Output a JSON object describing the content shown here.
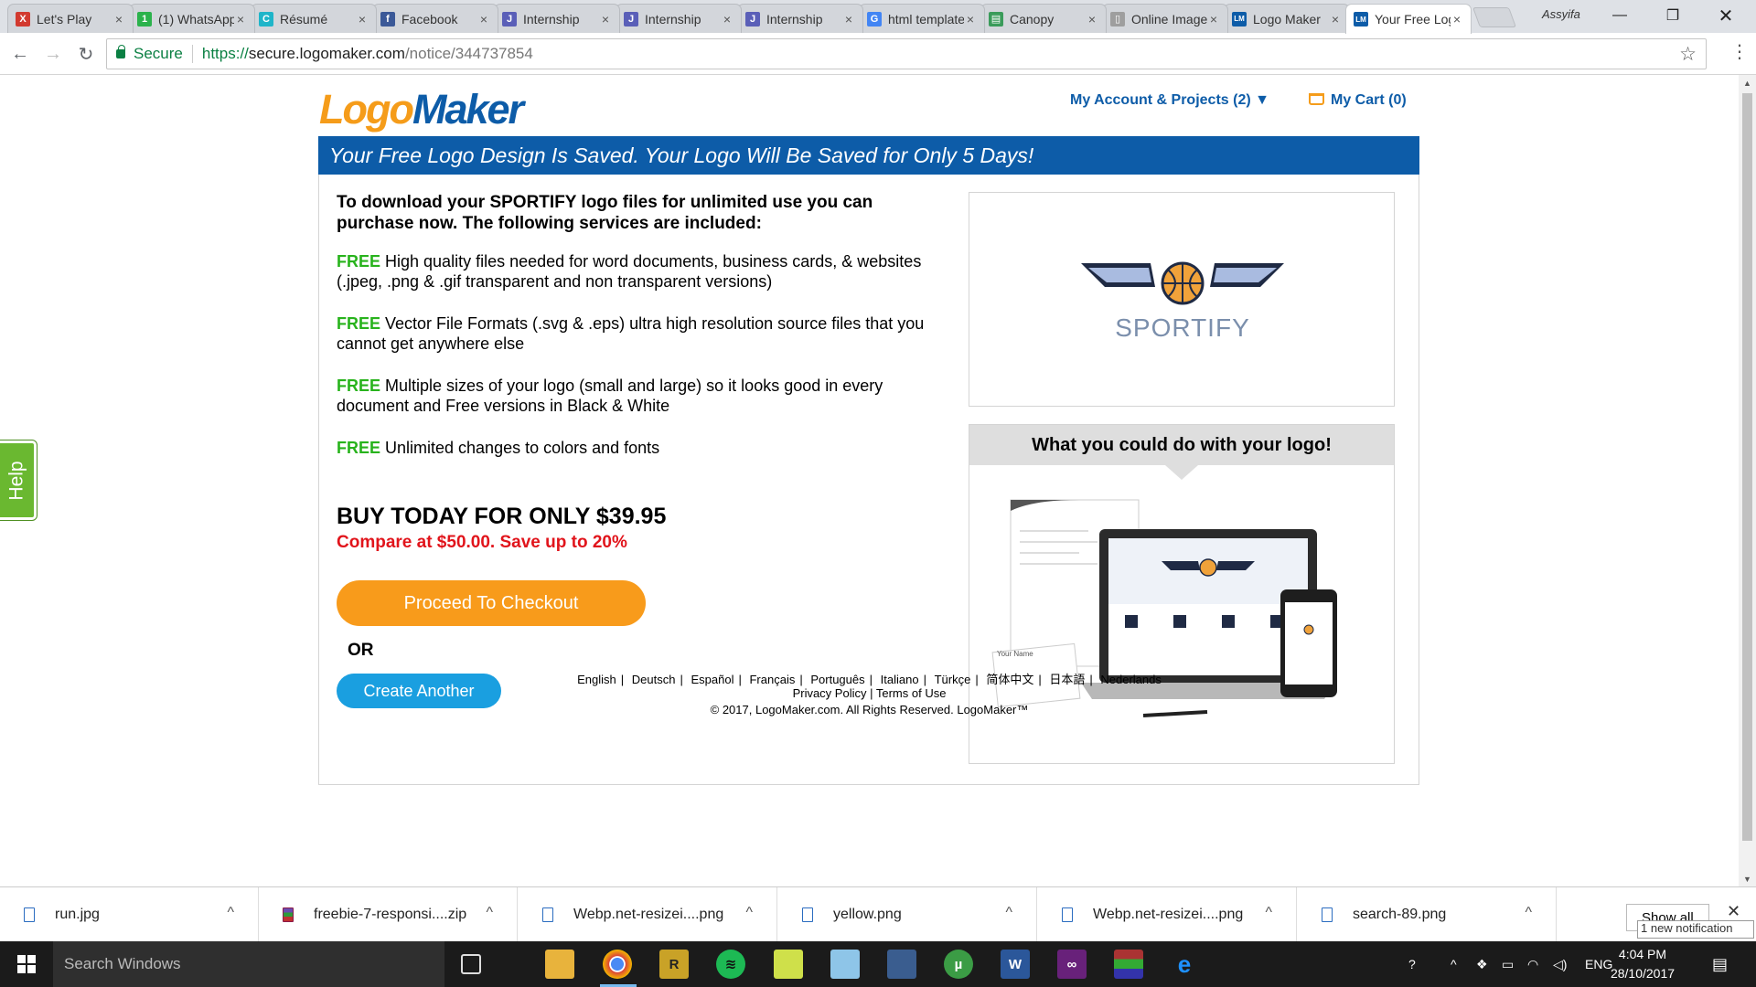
{
  "browser": {
    "tabs": [
      {
        "title": "Let's Play",
        "icon_color": "#d23a2f",
        "icon_glyph": "X"
      },
      {
        "title": "(1) WhatsApp",
        "icon_color": "#2bb24c",
        "icon_glyph": "1"
      },
      {
        "title": "Résumé",
        "icon_color": "#1fb5c9",
        "icon_glyph": "C"
      },
      {
        "title": "Facebook",
        "icon_color": "#3b5998",
        "icon_glyph": "f"
      },
      {
        "title": "Internship",
        "icon_color": "#5a5fb8",
        "icon_glyph": "J"
      },
      {
        "title": "Internship",
        "icon_color": "#5a5fb8",
        "icon_glyph": "J"
      },
      {
        "title": "Internship",
        "icon_color": "#5a5fb8",
        "icon_glyph": "J"
      },
      {
        "title": "html template",
        "icon_color": "#4285f4",
        "icon_glyph": "G"
      },
      {
        "title": "Canopy",
        "icon_color": "#3a9b5a",
        "icon_glyph": "▤"
      },
      {
        "title": "Online Image",
        "icon_color": "#9e9e9e",
        "icon_glyph": "▯"
      },
      {
        "title": "Logo Maker",
        "icon_color": "#0d5ca8",
        "icon_glyph": "LM"
      },
      {
        "title": "Your Free Logo",
        "icon_color": "#0d5ca8",
        "icon_glyph": "LM"
      }
    ],
    "active_tab": 11,
    "close_glyph": "×",
    "profile_name": "Assyifa",
    "secure_label": "Secure",
    "url_scheme": "https://",
    "url_host": "secure.logomaker.com",
    "url_path": "/notice/344737854"
  },
  "header": {
    "logo_part1": "Logo",
    "logo_part2": "Maker",
    "account_link": "My Account & Projects (2) ▼",
    "cart_link": "My Cart (0)",
    "brand_orange": "#f59c1a",
    "brand_blue": "#0d5ca8"
  },
  "banner": {
    "text": "Your Free Logo Design Is Saved. Your Logo Will Be Saved for Only 5 Days!"
  },
  "offer": {
    "intro": "To download your SPORTIFY logo files for unlimited use you can purchase now. The following services are included:",
    "free_label": "FREE",
    "features": [
      "High quality files needed for word documents, business cards, & websites (.jpeg, .png & .gif transparent and non transparent versions)",
      "Vector File Formats (.svg & .eps) ultra high resolution source files that you cannot get anywhere else",
      "Multiple sizes of your logo (small and large) so it looks good in every document and Free versions in Black & White",
      "Unlimited changes to colors and fonts"
    ],
    "buy_text": "BUY TODAY FOR ONLY $39.95",
    "compare_text": "Compare at $50.00. Save up to 20%",
    "checkout_label": "Proceed To Checkout",
    "or_label": "OR",
    "create_label": "Create Another"
  },
  "preview": {
    "brand_name": "SPORTIFY"
  },
  "usage": {
    "heading": "What you could do with your logo!",
    "card_name": "Your Name"
  },
  "help_label": "Help",
  "footer": {
    "languages": [
      "English",
      "Deutsch",
      "Español",
      "Français",
      "Português",
      "Italiano",
      "Türkçe",
      "简体中文",
      "日本語",
      "Nederlands"
    ],
    "privacy": "Privacy Policy",
    "terms": "Terms of Use",
    "copyright": "© 2017, LogoMaker.com. All Rights Reserved. LogoMaker™"
  },
  "downloads": {
    "files": [
      "run.jpg",
      "freebie-7-responsi....zip",
      "Webp.net-resizei....png",
      "yellow.png",
      "Webp.net-resizei....png",
      "search-89.png"
    ],
    "show_all": "Show all",
    "notification": "1 new notification"
  },
  "taskbar": {
    "search_placeholder": "Search Windows",
    "language": "ENG",
    "time": "4:04 PM",
    "date": "28/10/2017"
  }
}
